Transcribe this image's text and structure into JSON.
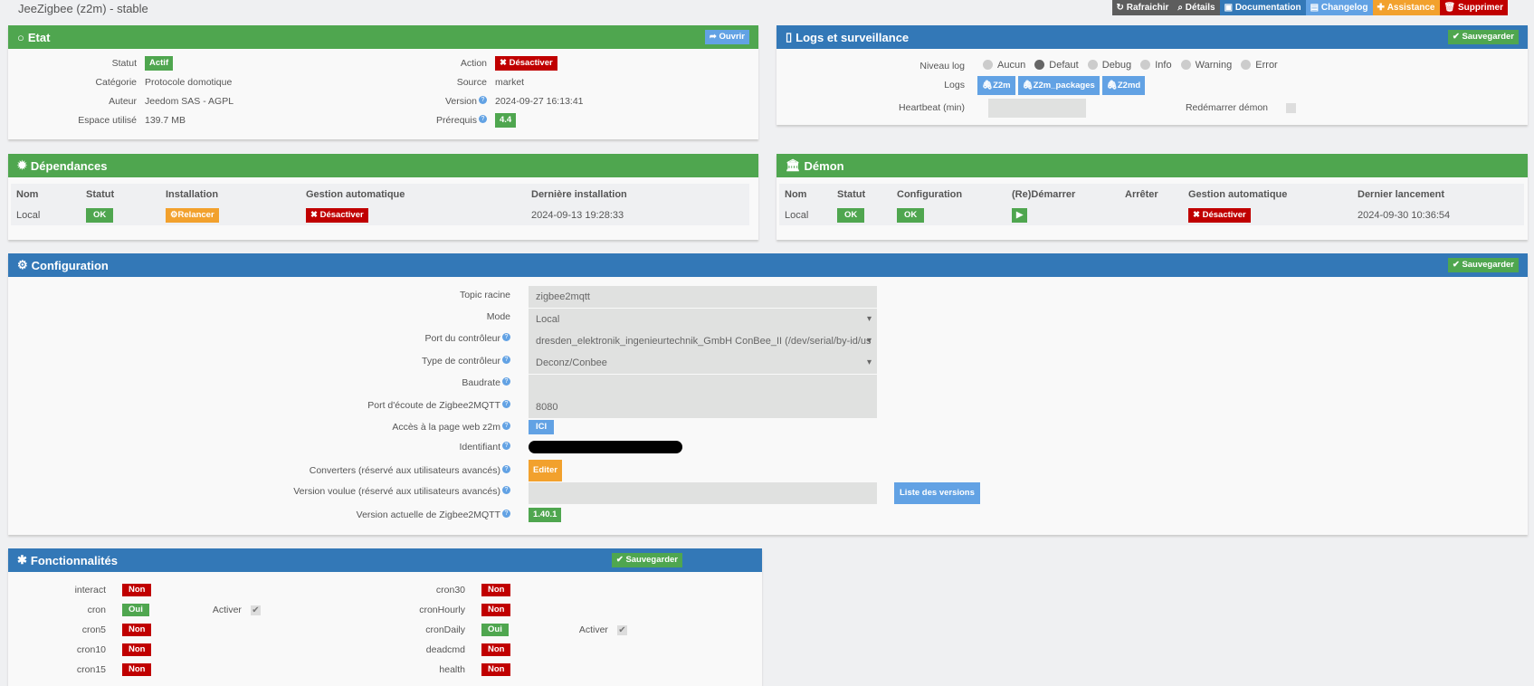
{
  "title": "JeeZigbee (z2m) - stable",
  "topbar": [
    {
      "label": "Rafraichir",
      "icon": "refresh-icon",
      "color": "#5d5d5d"
    },
    {
      "label": "Détails",
      "icon": "search-icon",
      "color": "#5d5d5d"
    },
    {
      "label": "Documentation",
      "icon": "book-icon",
      "color": "#3378b7"
    },
    {
      "label": "Changelog",
      "icon": "file-icon",
      "color": "#62a2e4"
    },
    {
      "label": "Assistance",
      "icon": "ambulance-icon",
      "color": "#f2a12d"
    },
    {
      "label": "Supprimer",
      "icon": "trash-icon",
      "color": "#c00000"
    }
  ],
  "etat": {
    "title": "Etat",
    "open": "Ouvrir",
    "left": [
      {
        "label": "Statut",
        "value": "Actif"
      },
      {
        "label": "Catégorie",
        "value": "Protocole domotique"
      },
      {
        "label": "Auteur",
        "value": "Jeedom SAS - AGPL"
      },
      {
        "label": "Espace utilisé",
        "value": "139.7 MB"
      }
    ],
    "right": [
      {
        "label": "Action",
        "value": "Désactiver"
      },
      {
        "label": "Source",
        "value": "market"
      },
      {
        "label": "Version",
        "value": "2024-09-27 16:13:41"
      },
      {
        "label": "Prérequis",
        "value": "4.4"
      }
    ]
  },
  "logs": {
    "title": "Logs et surveillance",
    "save": "Sauvegarder",
    "level_label": "Niveau log",
    "levels": [
      "Aucun",
      "Defaut",
      "Debug",
      "Info",
      "Warning",
      "Error"
    ],
    "selected_level": "Defaut",
    "logs_label": "Logs",
    "log_buttons": [
      "Z2m",
      "Z2m_packages",
      "Z2md"
    ],
    "heartbeat_label": "Heartbeat (min)",
    "heartbeat_value": "",
    "restart_label": "Redémarrer démon",
    "restart_checked": false
  },
  "deps": {
    "title": "Dépendances",
    "headers": [
      "Nom",
      "Statut",
      "Installation",
      "Gestion automatique",
      "Dernière installation"
    ],
    "row": {
      "name": "Local",
      "status": "OK",
      "install": "Relancer",
      "auto": "Désactiver",
      "last": "2024-09-13 19:28:33"
    }
  },
  "demon": {
    "title": "Démon",
    "headers": [
      "Nom",
      "Statut",
      "Configuration",
      "(Re)Démarrer",
      "Arrêter",
      "Gestion automatique",
      "Dernier lancement"
    ],
    "row": {
      "name": "Local",
      "status": "OK",
      "config": "OK",
      "auto": "Désactiver",
      "last": "2024-09-30 10:36:54"
    }
  },
  "config": {
    "title": "Configuration",
    "save": "Sauvegarder",
    "topic_label": "Topic racine",
    "topic": "zigbee2mqtt",
    "mode_label": "Mode",
    "mode": "Local",
    "port_label": "Port du contrôleur",
    "port": "dresden_elektronik_ingenieurtechnik_GmbH ConBee_II (/dev/serial/by-id/us",
    "type_label": "Type de contrôleur",
    "type": "Deconz/Conbee",
    "baud_label": "Baudrate",
    "baud": "",
    "listen_label": "Port d'écoute de Zigbee2MQTT",
    "listen": "8080",
    "web_label": "Accès à la page web z2m",
    "web_btn": "ICI",
    "id_label": "Identifiant",
    "conv_label": "Converters (réservé aux utilisateurs avancés)",
    "conv_btn": "Editer",
    "want_label": "Version voulue (réservé aux utilisateurs avancés)",
    "want": "",
    "versions_btn": "Liste des versions",
    "cur_label": "Version actuelle de Zigbee2MQTT",
    "cur": "1.40.1"
  },
  "func": {
    "title": "Fonctionnalités",
    "save": "Sauvegarder",
    "activate": "Activer",
    "left": [
      {
        "name": "interact",
        "v": "Non"
      },
      {
        "name": "cron",
        "v": "Oui"
      },
      {
        "name": "cron5",
        "v": "Non"
      },
      {
        "name": "cron10",
        "v": "Non"
      },
      {
        "name": "cron15",
        "v": "Non"
      }
    ],
    "right": [
      {
        "name": "cron30",
        "v": "Non"
      },
      {
        "name": "cronHourly",
        "v": "Non"
      },
      {
        "name": "cronDaily",
        "v": "Oui"
      },
      {
        "name": "deadcmd",
        "v": "Non"
      },
      {
        "name": "health",
        "v": "Non"
      }
    ]
  }
}
